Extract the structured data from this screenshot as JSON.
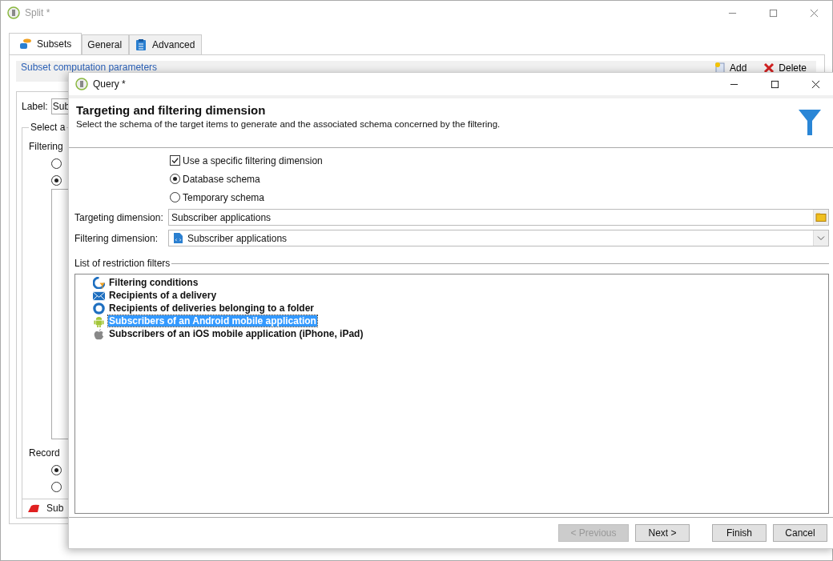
{
  "background_window": {
    "title": "Split *",
    "tabs": [
      {
        "label": "Subsets",
        "kind": "subsets",
        "selected": true
      },
      {
        "label": "General",
        "kind": "general",
        "selected": false
      },
      {
        "label": "Advanced",
        "kind": "advanced",
        "selected": false
      }
    ],
    "section_title": "Subset computation parameters",
    "toolbar": [
      {
        "label": "Add",
        "kind": "add"
      },
      {
        "label": "Delete",
        "kind": "delete"
      }
    ],
    "label_field": {
      "label": "Label:",
      "value": "Sub"
    },
    "group_title": "Select a",
    "filtering_label": "Filtering",
    "filtering_options": [
      {
        "selected": false
      },
      {
        "selected": true
      }
    ],
    "record_label": "Record",
    "record_options": [
      {
        "selected": true
      },
      {
        "selected": false
      }
    ],
    "subtab": "Sub"
  },
  "query_dialog": {
    "title": "Query *",
    "heading": "Targeting and filtering dimension",
    "description": "Select the schema of the target items to  generate and the associated schema concerned by the filtering.",
    "use_specific": {
      "label": "Use a specific filtering dimension",
      "checked": true
    },
    "schema_options": [
      {
        "label": "Database schema",
        "selected": true
      },
      {
        "label": "Temporary schema",
        "selected": false
      }
    ],
    "targeting": {
      "label": "Targeting dimension:",
      "value": "Subscriber applications"
    },
    "filtering": {
      "label": "Filtering dimension:",
      "value": "Subscriber applications"
    },
    "filters_title": "List of restriction filters",
    "filters": [
      {
        "label": "Filtering conditions",
        "kind": "conditions",
        "selected": false
      },
      {
        "label": "Recipients of a delivery",
        "kind": "delivery",
        "selected": false
      },
      {
        "label": "Recipients of deliveries belonging to a folder",
        "kind": "folder",
        "selected": false
      },
      {
        "label": "Subscribers of an Android mobile application",
        "kind": "android",
        "selected": true
      },
      {
        "label": "Subscribers of an iOS mobile application (iPhone, iPad)",
        "kind": "apple",
        "selected": false
      }
    ],
    "buttons": [
      {
        "label": "< Previous",
        "disabled": true
      },
      {
        "label": "Next >",
        "disabled": false
      },
      {
        "label": "Finish",
        "disabled": false
      },
      {
        "label": "Cancel",
        "disabled": false
      }
    ]
  }
}
